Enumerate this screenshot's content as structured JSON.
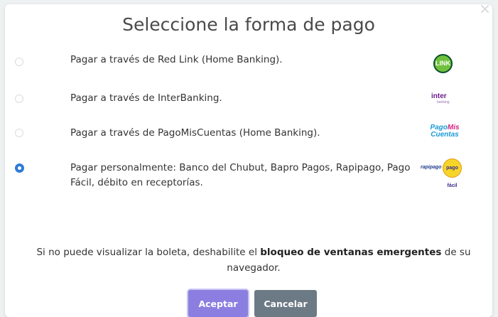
{
  "dialog": {
    "title": "Seleccione la forma de pago",
    "close_glyph": "×"
  },
  "options": [
    {
      "label": "Pagar a través de Red Link (Home Banking).",
      "selected": false,
      "logo": "red-link-logo",
      "logo_text": "LINK"
    },
    {
      "label": "Pagar a través de InterBanking.",
      "selected": false,
      "logo": "interbanking-logo",
      "logo_text": "inter",
      "logo_subtext": "banking"
    },
    {
      "label": "Pagar a través de PagoMisCuentas (Home Banking).",
      "selected": false,
      "logo": "pagomiscuentas-logo",
      "logo_text_1": "Pago",
      "logo_text_2": "Mis",
      "logo_text_3": "Cuentas"
    },
    {
      "label": "Pagar personalmente: Banco del Chubut, Bapro Pagos, Rapipago, Pago Fácil, débito en receptorías.",
      "selected": true,
      "logo": "rapipago-pagofacil-logo",
      "logo_text_1": "rapipago",
      "logo_text_2": "pago fácil"
    }
  ],
  "notice": {
    "prefix": "Si no puede visualizar la boleta, deshabilite el ",
    "bold": "bloqueo de ventanas emergentes",
    "suffix": " de su navegador."
  },
  "buttons": {
    "accept_label": "Aceptar",
    "cancel_label": "Cancelar"
  },
  "colors": {
    "radio_selected": "#2e7bd6",
    "accept_button": "#8a7fe0",
    "cancel_button": "#6c7a85"
  }
}
